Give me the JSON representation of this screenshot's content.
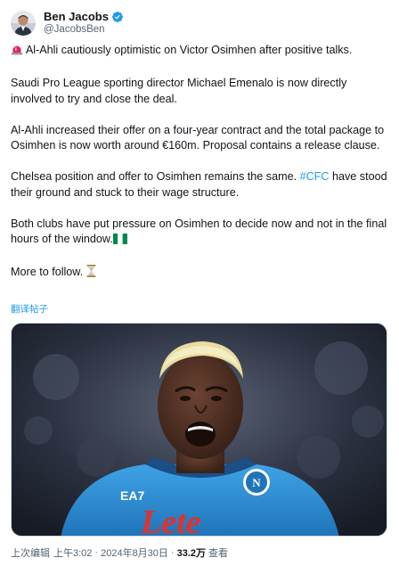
{
  "author": {
    "display_name": "Ben Jacobs",
    "handle": "@JacobsBen",
    "verified_icon": "verified-badge-icon"
  },
  "tweet": {
    "emoji_siren": "siren-icon",
    "headline": "Al-Ahli cautiously optimistic on Victor Osimhen after positive talks.",
    "para2": "Saudi Pro League sporting director Michael Emenalo is now directly involved to try and close the deal.",
    "para3": "Al-Ahli increased their offer on a four-year contract and the total package to Osimhen is now worth around €160m. Proposal contains a release clause.",
    "para4_before": "Chelsea position and offer to Osimhen remains the same. ",
    "para4_hashtag": "#CFC",
    "para4_after": " have stood their ground and stuck to their wage structure.",
    "para5": "Both clubs have put pressure on Osimhen to decide now and not in the final hours of the window.",
    "emoji_flag": "nigeria-flag-icon",
    "para6": "More to follow.",
    "emoji_hourglass": "hourglass-icon",
    "translate_label": "翻译帖子"
  },
  "media": {
    "description_icon": "player-photo",
    "jersey_brand": "EA7",
    "jersey_sponsor": "Lete",
    "badge_letter": "N"
  },
  "meta": {
    "edited_label": "上次编辑",
    "time": "上午3:02",
    "separator": "·",
    "date": "2024年8月30日",
    "views_count": "33.2万",
    "views_label": "查看"
  },
  "colors": {
    "accent": "#1d9bf0",
    "text_primary": "#0f1419",
    "text_secondary": "#536471",
    "siren": "#e0245e",
    "flag_green": "#008751",
    "jersey_blue": "#2a8fd6"
  }
}
